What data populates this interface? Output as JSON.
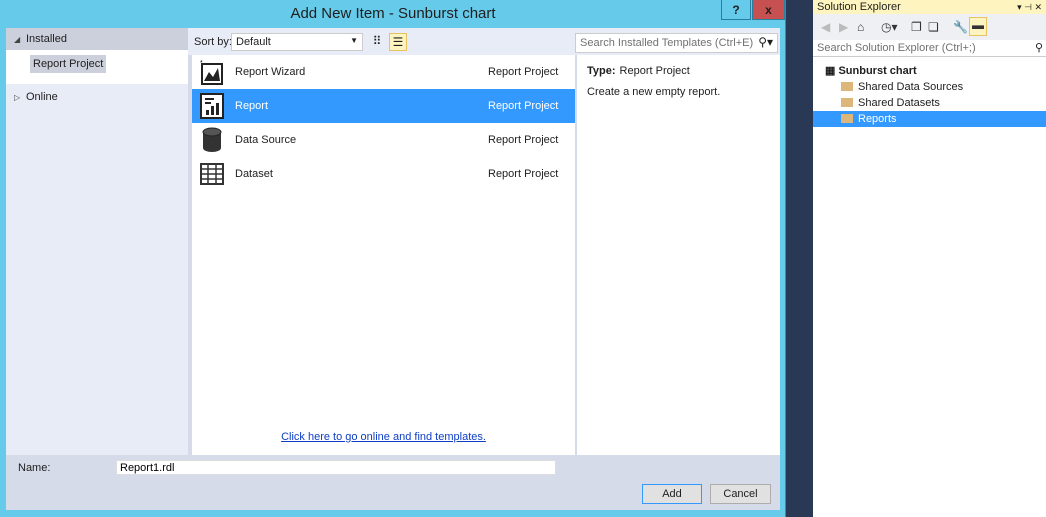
{
  "dialog": {
    "title": "Add New Item - Sunburst chart",
    "help": "?",
    "close": "x",
    "left": {
      "installed": "Installed",
      "selected": "Report Project",
      "online": "Online"
    },
    "sort": {
      "label": "Sort by:",
      "value": "Default"
    },
    "search_placeholder": "Search Installed Templates (Ctrl+E)",
    "templates": [
      {
        "name": "Report Wizard",
        "type": "Report Project",
        "icon": "report-wizard-icon"
      },
      {
        "name": "Report",
        "type": "Report Project",
        "icon": "report-icon",
        "selected": true
      },
      {
        "name": "Data Source",
        "type": "Report Project",
        "icon": "database-icon"
      },
      {
        "name": "Dataset",
        "type": "Report Project",
        "icon": "table-icon"
      }
    ],
    "online_link": "Click here to go online and find templates.",
    "detail": {
      "type_label": "Type:",
      "type_value": "Report Project",
      "description": "Create a new empty report."
    },
    "name_label": "Name:",
    "name_value": "Report1.rdl",
    "add": "Add",
    "cancel": "Cancel"
  },
  "solution_explorer": {
    "title": "Solution Explorer",
    "search_placeholder": "Search Solution Explorer (Ctrl+;)",
    "solution": "Sunburst chart",
    "folders": [
      "Shared Data Sources",
      "Shared Datasets",
      "Reports"
    ],
    "selected_folder": "Reports"
  },
  "colors": {
    "accent": "#3399ff",
    "frame": "#66cbea",
    "close": "#c75050"
  }
}
